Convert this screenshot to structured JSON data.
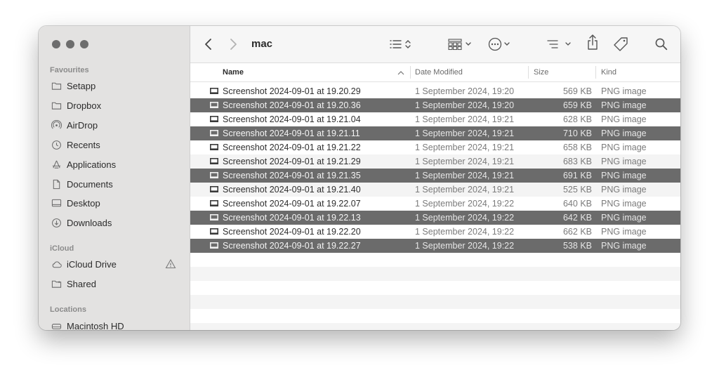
{
  "window": {
    "title": "mac"
  },
  "sidebar": {
    "sections": [
      {
        "label": "Favourites",
        "items": [
          {
            "label": "Setapp",
            "icon": "folder-icon"
          },
          {
            "label": "Dropbox",
            "icon": "folder-icon"
          },
          {
            "label": "AirDrop",
            "icon": "airdrop-icon"
          },
          {
            "label": "Recents",
            "icon": "clock-icon"
          },
          {
            "label": "Applications",
            "icon": "applications-icon"
          },
          {
            "label": "Documents",
            "icon": "document-icon"
          },
          {
            "label": "Desktop",
            "icon": "desktop-icon"
          },
          {
            "label": "Downloads",
            "icon": "download-icon"
          }
        ]
      },
      {
        "label": "iCloud",
        "items": [
          {
            "label": "iCloud Drive",
            "icon": "cloud-icon",
            "badge": "warning-icon"
          },
          {
            "label": "Shared",
            "icon": "shared-folder-icon"
          }
        ]
      },
      {
        "label": "Locations",
        "items": [
          {
            "label": "Macintosh HD",
            "icon": "hard-drive-icon"
          }
        ]
      }
    ]
  },
  "toolbar": {
    "buttons": [
      "back-icon",
      "forward-icon",
      "list-view-icon",
      "grid-view-icon",
      "more-icon",
      "group-icon",
      "share-icon",
      "tag-icon",
      "search-icon"
    ]
  },
  "columns": {
    "name": "Name",
    "date": "Date Modified",
    "size": "Size",
    "kind": "Kind"
  },
  "files": [
    {
      "name": "Screenshot 2024-09-01 at 19.20.29",
      "date": "1 September 2024, 19:20",
      "size": "569 KB",
      "kind": "PNG image",
      "selected": false
    },
    {
      "name": "Screenshot 2024-09-01 at 19.20.36",
      "date": "1 September 2024, 19:20",
      "size": "659 KB",
      "kind": "PNG image",
      "selected": true
    },
    {
      "name": "Screenshot 2024-09-01 at 19.21.04",
      "date": "1 September 2024, 19:21",
      "size": "628 KB",
      "kind": "PNG image",
      "selected": false
    },
    {
      "name": "Screenshot 2024-09-01 at 19.21.11",
      "date": "1 September 2024, 19:21",
      "size": "710 KB",
      "kind": "PNG image",
      "selected": true
    },
    {
      "name": "Screenshot 2024-09-01 at 19.21.22",
      "date": "1 September 2024, 19:21",
      "size": "658 KB",
      "kind": "PNG image",
      "selected": false
    },
    {
      "name": "Screenshot 2024-09-01 at 19.21.29",
      "date": "1 September 2024, 19:21",
      "size": "683 KB",
      "kind": "PNG image",
      "selected": false
    },
    {
      "name": "Screenshot 2024-09-01 at 19.21.35",
      "date": "1 September 2024, 19:21",
      "size": "691 KB",
      "kind": "PNG image",
      "selected": true
    },
    {
      "name": "Screenshot 2024-09-01 at 19.21.40",
      "date": "1 September 2024, 19:21",
      "size": "525 KB",
      "kind": "PNG image",
      "selected": false
    },
    {
      "name": "Screenshot 2024-09-01 at 19.22.07",
      "date": "1 September 2024, 19:22",
      "size": "640 KB",
      "kind": "PNG image",
      "selected": false
    },
    {
      "name": "Screenshot 2024-09-01 at 19.22.13",
      "date": "1 September 2024, 19:22",
      "size": "642 KB",
      "kind": "PNG image",
      "selected": true
    },
    {
      "name": "Screenshot 2024-09-01 at 19.22.20",
      "date": "1 September 2024, 19:22",
      "size": "662 KB",
      "kind": "PNG image",
      "selected": false
    },
    {
      "name": "Screenshot 2024-09-01 at 19.22.27",
      "date": "1 September 2024, 19:22",
      "size": "538 KB",
      "kind": "PNG image",
      "selected": true
    }
  ]
}
